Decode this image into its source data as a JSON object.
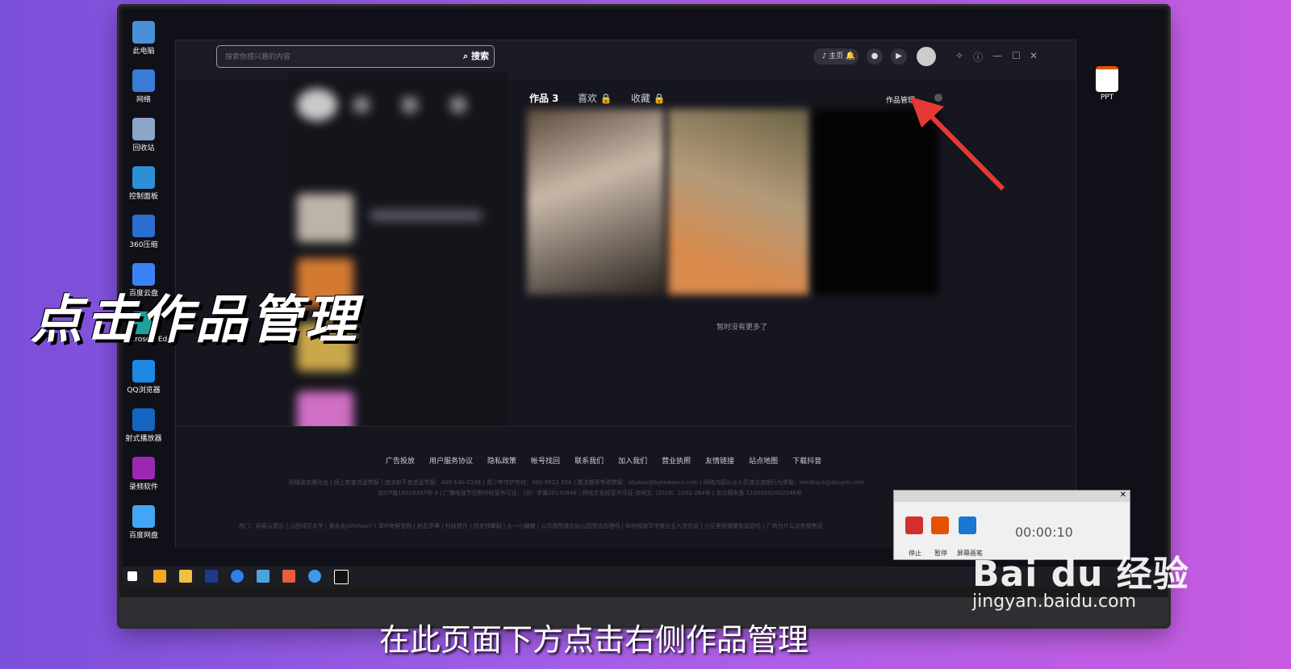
{
  "desktop": {
    "icons": [
      {
        "label": "此电脑",
        "color": "#4a90d9"
      },
      {
        "label": "网络",
        "color": "#3a7bd5"
      },
      {
        "label": "回收站",
        "color": "#8aa6c8"
      },
      {
        "label": "控制面板",
        "color": "#2d8fd5"
      },
      {
        "label": "360压缩",
        "color": "#2b6fd0"
      },
      {
        "label": "百度云盘",
        "color": "#3b82f6"
      },
      {
        "label": "Microsoft Edge",
        "color": "#1f9f9a"
      },
      {
        "label": "QQ浏览器",
        "color": "#1e88e5"
      },
      {
        "label": "射式播放器",
        "color": "#1565c0"
      },
      {
        "label": "录频软件",
        "color": "#9c27b0"
      },
      {
        "label": "百度网盘",
        "color": "#42a5f5"
      }
    ],
    "right_icon": "PPT"
  },
  "app": {
    "search_placeholder": "搜索你感兴趣的内容",
    "search_button": "搜索",
    "home_label": "主页",
    "tabs": [
      {
        "label": "作品 3",
        "active": true
      },
      {
        "label": "喜欢",
        "locked": true
      },
      {
        "label": "收藏",
        "locked": true
      }
    ],
    "manage_link": "作品管理",
    "no_more": "暂时没有更多了",
    "footer_links": [
      "广告投放",
      "用户服务协议",
      "隐私政策",
      "帐号找回",
      "联系我们",
      "加入我们",
      "营业执照",
      "友情链接",
      "站点地图",
      "下载抖音"
    ],
    "footer_line1": "网络谣言曝光台 | 网上有害信息举报 | 违法和不良信息举报：400-140-2108 | 青少年守护专线：400-9922-556 | 算法推荐专项举报：sfjubao@bytedance.com | 网络内容从业人员违法违规行为举报：feedback@douyin.com",
    "footer_line2": "京ICP备16016397号-3 | 广播电视节目制作经营许可证：（京）字第20170848 | 网络文化经营许可证-京网文（2016）2282-264号 | 京公网安备 11000002002046号",
    "footer_line3": "热门：网易云音乐 | 山西师范大学 | 侯永永Johnhou7 | 漳州有鲜宅购 | 帕瓦罗蒂 | 科技提升 | 叔老师舞蹈 | 久一小糖糖 | 公共厕所建在幼儿园旁边合理吗 | 如何知道写字楼业主入住信息 | 小区里面楼楼有监控吗 | 广房为什么没有预售证"
  },
  "overlay": {
    "caption_big": "点击作品管理",
    "caption_sub": "在此页面下方点击右侧作品管理"
  },
  "recorder": {
    "timer": "00:00:10",
    "stop": "停止",
    "pause": "暂停",
    "screen": "屏幕画笔"
  },
  "watermark": {
    "brand": "Bai du 经验",
    "url": "jingyan.baidu.com"
  },
  "colors": {
    "arrow": "#e53935"
  }
}
